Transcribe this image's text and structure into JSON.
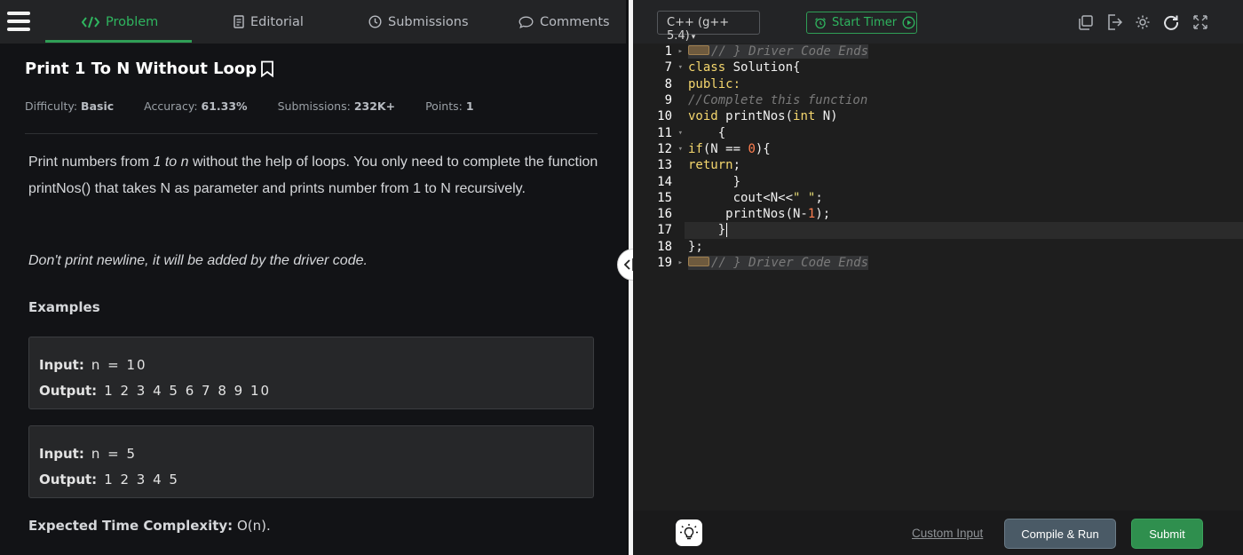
{
  "tabs": [
    {
      "label": "Problem",
      "icon": "code-icon"
    },
    {
      "label": "Editorial",
      "icon": "document-icon"
    },
    {
      "label": "Submissions",
      "icon": "clock-icon"
    },
    {
      "label": "Comments",
      "icon": "chat-icon"
    }
  ],
  "problem": {
    "title": "Print 1 To N Without Loop",
    "meta": {
      "difficulty_label": "Difficulty:",
      "difficulty": "Basic",
      "accuracy_label": "Accuracy:",
      "accuracy": "61.33%",
      "submissions_label": "Submissions:",
      "submissions": "232K+",
      "points_label": "Points:",
      "points": "1"
    },
    "desc_part1": "Print numbers from ",
    "desc_italic": "1 to n",
    "desc_part2": " without the help of loops. You only need to complete the function printNos() that takes N as parameter and prints number from 1 to N recursively.",
    "note": "Don't print newline, it will be added by the driver code.",
    "examples_heading": "Examples",
    "examples": [
      {
        "input_label": "Input:",
        "input": "n = 10",
        "output_label": "Output:",
        "output": "1 2 3 4 5 6 7 8 9 10"
      },
      {
        "input_label": "Input:",
        "input": "n = 5",
        "output_label": "Output:",
        "output": "1 2 3 4 5"
      }
    ],
    "etc_label": "Expected Time Complexity:",
    "etc_value": "O(n)."
  },
  "editor": {
    "language": "C++ (g++ 5.4)",
    "timer_label": "Start Timer",
    "line_numbers": [
      "1",
      "7",
      "8",
      "9",
      "10",
      "11",
      "12",
      "13",
      "14",
      "15",
      "16",
      "17",
      "18",
      "19"
    ],
    "custom_input_label": "Custom Input",
    "compile_label": "Compile & Run",
    "submit_label": "Submit"
  },
  "colors": {
    "accent_green": "#2fb55f",
    "submit_green": "#2f8f4e",
    "run_slate": "#4a5a66"
  }
}
